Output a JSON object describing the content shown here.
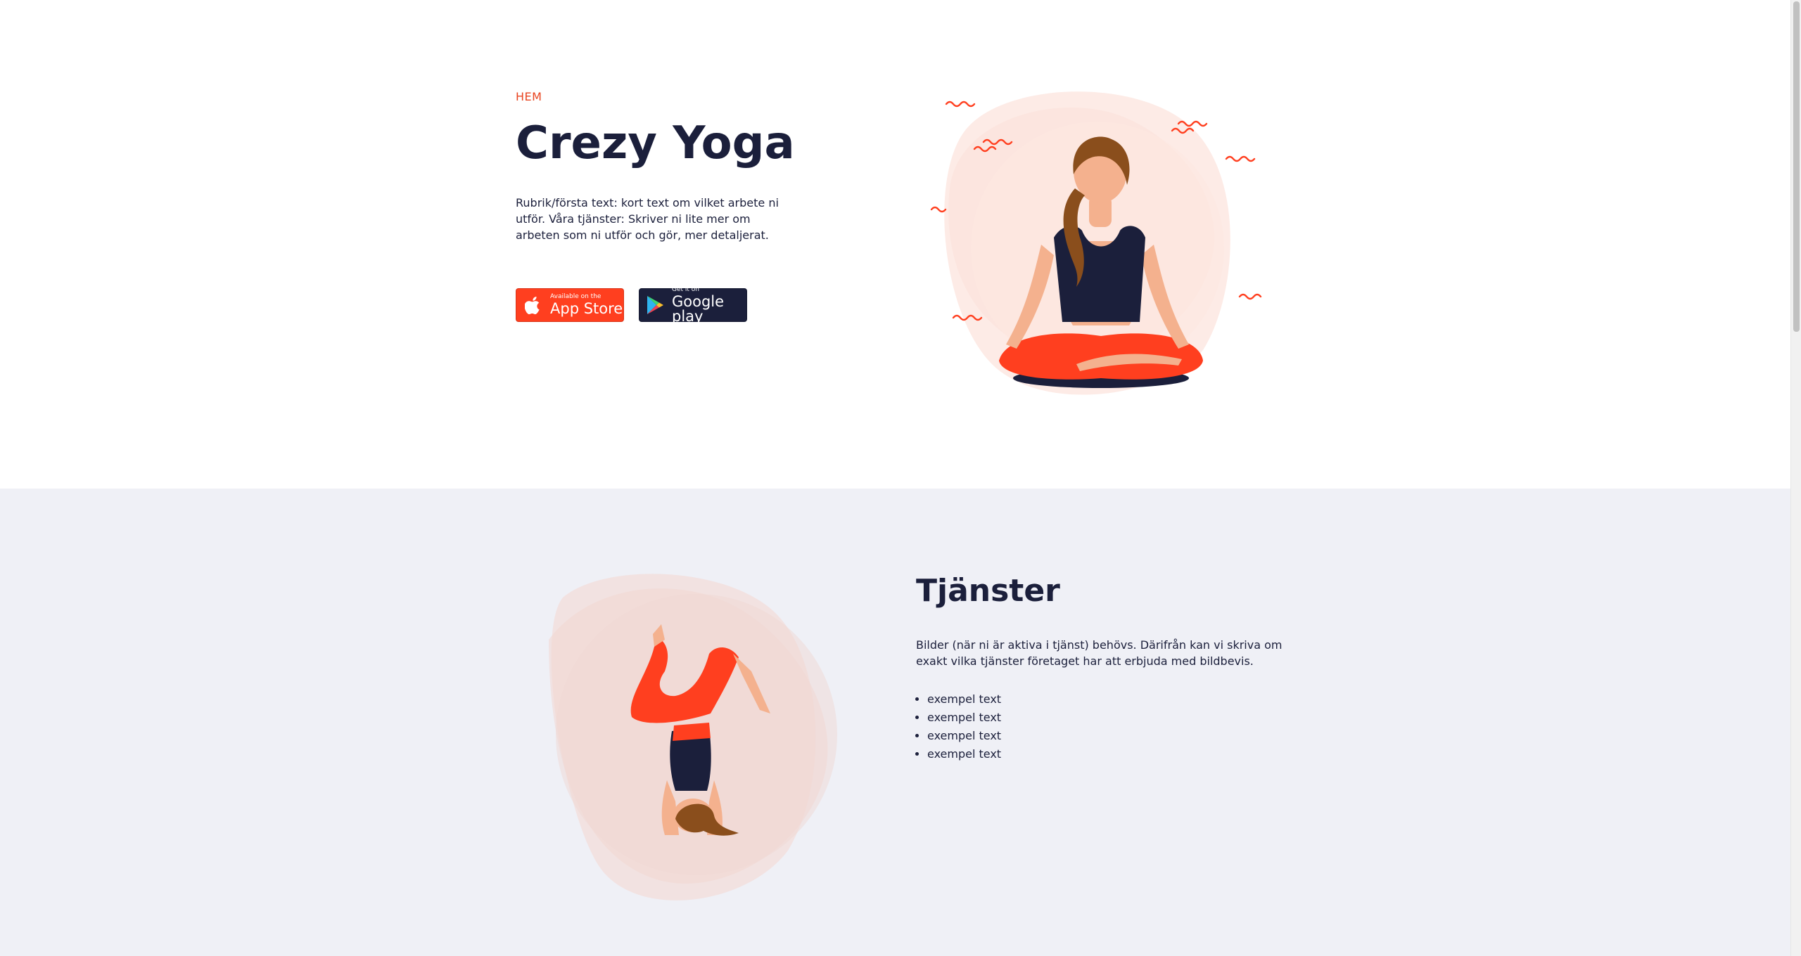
{
  "hero": {
    "label": "HEM",
    "title": "Crezy Yoga",
    "description": "Rubrik/första text: kort text om vilket arbete ni utför. Våra tjänster: Skriver ni lite mer om arbeten som ni utför och gör, mer detaljerat.",
    "app_store": {
      "small": "Available on the",
      "big": "App Store"
    },
    "google_play": {
      "small": "Get it on",
      "big": "Google play"
    }
  },
  "services": {
    "title": "Tjänster",
    "description": "Bilder (när ni är aktiva i tjänst) behövs. Därifrån kan vi skriva om exakt vilka tjänster företaget har att erbjuda med bildbevis.",
    "items": [
      "exempel text",
      "exempel text",
      "exempel text",
      "exempel text"
    ]
  },
  "colors": {
    "accent": "#ff3f1f",
    "navy": "#1b1f3b",
    "section_bg": "#eff0f6"
  }
}
